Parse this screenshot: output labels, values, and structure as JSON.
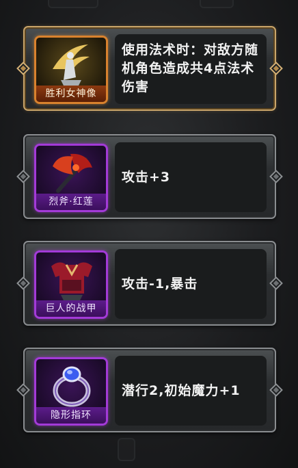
{
  "cards": [
    {
      "name": "胜利女神像",
      "desc": "使用法术时：对敌方随机角色造成共4点法术伤害",
      "rarity": "legendary",
      "icon": "victory-goddess-statue-icon"
    },
    {
      "name": "烈斧·红莲",
      "desc": "攻击+3",
      "rarity": "epic",
      "icon": "crimson-lotus-axe-icon"
    },
    {
      "name": "巨人的战甲",
      "desc": "攻击-1,暴击",
      "rarity": "epic",
      "icon": "giant-armor-icon"
    },
    {
      "name": "隐形指环",
      "desc": "潜行2,初始魔力+1",
      "rarity": "epic",
      "icon": "invisibility-ring-icon"
    }
  ],
  "colors": {
    "legendary": "#d9822e",
    "epic": "#a33ad8"
  }
}
